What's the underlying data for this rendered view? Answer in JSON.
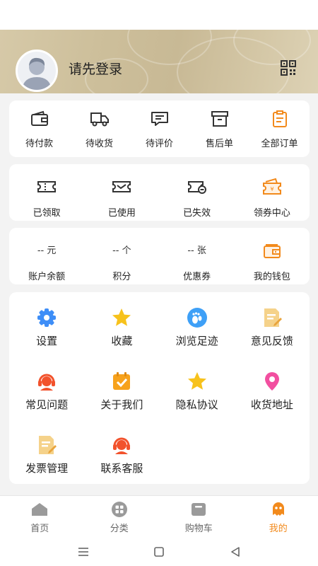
{
  "header": {
    "login_text": "请先登录",
    "qr_icon": "qr-code-icon",
    "avatar_icon": "default-avatar-icon"
  },
  "orders": [
    {
      "label": "待付款",
      "icon": "wallet-icon"
    },
    {
      "label": "待收货",
      "icon": "truck-icon"
    },
    {
      "label": "待评价",
      "icon": "comment-icon"
    },
    {
      "label": "售后单",
      "icon": "box-icon"
    },
    {
      "label": "全部订单",
      "icon": "clipboard-icon"
    }
  ],
  "coupons": [
    {
      "label": "已领取",
      "icon": "ticket-icon"
    },
    {
      "label": "已使用",
      "icon": "ticket-check-icon"
    },
    {
      "label": "已失效",
      "icon": "ticket-expired-icon"
    },
    {
      "label": "领券中心",
      "icon": "coupon-center-icon"
    }
  ],
  "assets": [
    {
      "value": "-- 元",
      "label": "账户余额"
    },
    {
      "value": "-- 个",
      "label": "积分"
    },
    {
      "value": "-- 张",
      "label": "优惠券"
    },
    {
      "value": "",
      "label": "我的钱包",
      "icon": "wallet-icon"
    }
  ],
  "services": [
    {
      "label": "设置",
      "icon": "gear-icon"
    },
    {
      "label": "收藏",
      "icon": "star-icon"
    },
    {
      "label": "浏览足迹",
      "icon": "footprint-icon"
    },
    {
      "label": "意见反馈",
      "icon": "feedback-icon"
    },
    {
      "label": "常见问题",
      "icon": "headset-icon"
    },
    {
      "label": "关于我们",
      "icon": "calendar-check-icon"
    },
    {
      "label": "隐私协议",
      "icon": "star-icon"
    },
    {
      "label": "收货地址",
      "icon": "location-pin-icon"
    },
    {
      "label": "发票管理",
      "icon": "invoice-icon"
    },
    {
      "label": "联系客服",
      "icon": "headset-icon"
    }
  ],
  "tabbar": [
    {
      "label": "首页",
      "icon": "home-icon",
      "active": false
    },
    {
      "label": "分类",
      "icon": "category-icon",
      "active": false
    },
    {
      "label": "购物车",
      "icon": "cart-icon",
      "active": false
    },
    {
      "label": "我的",
      "icon": "profile-icon",
      "active": true
    }
  ],
  "colors": {
    "accent": "#f28a1c",
    "blue": "#3e8ef7",
    "yellow": "#f7c21c",
    "red": "#f2522c",
    "pink": "#f24fa0",
    "gray_icon": "#444444"
  }
}
